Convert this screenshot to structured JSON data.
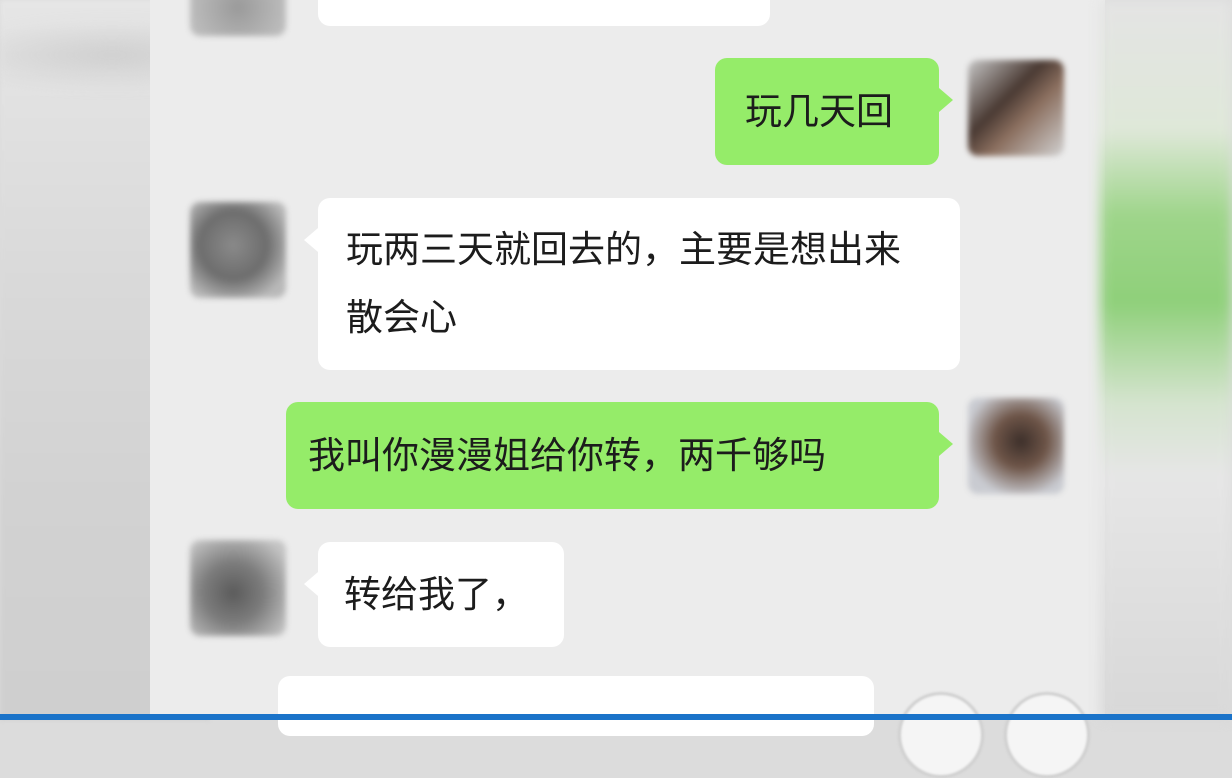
{
  "messages": [
    {
      "side": "right",
      "text": "玩几天回"
    },
    {
      "side": "left",
      "text": "玩两三天就回去的，主要是想出来散会心"
    },
    {
      "side": "right",
      "text": "我叫你漫漫姐给你转，两千够吗"
    },
    {
      "side": "left",
      "text": "转给我了，"
    }
  ],
  "colors": {
    "outgoing_bubble": "#95ec69",
    "incoming_bubble": "#ffffff",
    "chat_background": "#ececec",
    "bottom_bar": "#1a73c9"
  }
}
